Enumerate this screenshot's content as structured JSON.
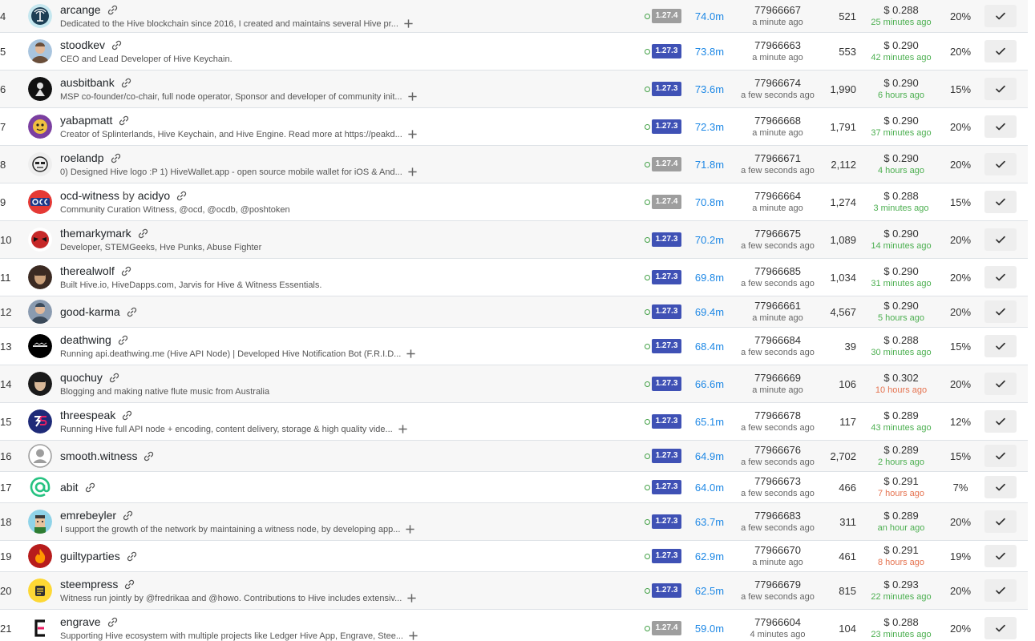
{
  "colors": {
    "version_current": "#3f51b5",
    "version_other": "#9e9e9e",
    "votes": "#1e88e5",
    "ago_recent": "#4caf50",
    "ago_stale": "#e57350",
    "status_online": "#43a047"
  },
  "witnesses": [
    {
      "rank": "4",
      "name": "arcange",
      "by": "",
      "proxy": "",
      "description": "Dedicated to the Hive blockchain since 2016, I created and maintains several Hive pr...",
      "expandable": true,
      "version": "1.27.4",
      "votes": "74.0m",
      "block": "77966667",
      "block_time": "a minute ago",
      "missed": "521",
      "price": "$ 0.288",
      "price_time": "25 minutes ago",
      "price_stale": false,
      "apr": "20%",
      "avatar_icon": "radio-tower-icon",
      "avatar_colors": [
        "#c5e7ef",
        "#1d3f55"
      ]
    },
    {
      "rank": "5",
      "name": "stoodkev",
      "by": "",
      "proxy": "",
      "description": "CEO and Lead Developer of Hive Keychain.",
      "expandable": false,
      "version": "1.27.3",
      "votes": "73.8m",
      "block": "77966663",
      "block_time": "a minute ago",
      "missed": "553",
      "price": "$ 0.290",
      "price_time": "42 minutes ago",
      "price_stale": false,
      "apr": "20%",
      "avatar_icon": "person-photo-icon",
      "avatar_colors": [
        "#a8c4de",
        "#6a4e3a"
      ]
    },
    {
      "rank": "6",
      "name": "ausbitbank",
      "by": "",
      "proxy": "",
      "description": "MSP co-founder/co-chair, full node operator, Sponsor and developer of community init...",
      "expandable": true,
      "version": "1.27.3",
      "votes": "73.6m",
      "block": "77966674",
      "block_time": "a few seconds ago",
      "missed": "1,990",
      "price": "$ 0.290",
      "price_time": "6 hours ago",
      "price_stale": false,
      "apr": "15%",
      "avatar_icon": "dark-figure-icon",
      "avatar_colors": [
        "#111111",
        "#e0e0e0"
      ]
    },
    {
      "rank": "7",
      "name": "yabapmatt",
      "by": "",
      "proxy": "",
      "description": "Creator of Splinterlands, Hive Keychain, and Hive Engine. Read more at https://peakd...",
      "expandable": true,
      "version": "1.27.3",
      "votes": "72.3m",
      "block": "77966668",
      "block_time": "a minute ago",
      "missed": "1,791",
      "price": "$ 0.290",
      "price_time": "37 minutes ago",
      "price_stale": false,
      "apr": "20%",
      "avatar_icon": "cartoon-face-icon",
      "avatar_colors": [
        "#7b3fa0",
        "#f0c040"
      ]
    },
    {
      "rank": "8",
      "name": "roelandp",
      "by": "",
      "proxy": "",
      "description": "0) Designed Hive logo :P 1) HiveWallet.app - open source mobile wallet for iOS & And...",
      "expandable": true,
      "version": "1.27.4",
      "votes": "71.8m",
      "block": "77966671",
      "block_time": "a few seconds ago",
      "missed": "2,112",
      "price": "$ 0.290",
      "price_time": "4 hours ago",
      "price_stale": false,
      "apr": "20%",
      "avatar_icon": "sketch-face-icon",
      "avatar_colors": [
        "#eeeeee",
        "#222222"
      ]
    },
    {
      "rank": "9",
      "name": "ocd-witness",
      "by": "by",
      "proxy": "acidyo",
      "description": "Community Curation Witness, @ocd, @ocdb, @poshtoken",
      "expandable": false,
      "version": "1.27.4",
      "votes": "70.8m",
      "block": "77966664",
      "block_time": "a minute ago",
      "missed": "1,274",
      "price": "$ 0.288",
      "price_time": "3 minutes ago",
      "price_stale": false,
      "apr": "15%",
      "avatar_icon": "ocd-logo-icon",
      "avatar_colors": [
        "#e53935",
        "#1e3a8a"
      ]
    },
    {
      "rank": "10",
      "name": "themarkymark",
      "by": "",
      "proxy": "",
      "description": "Developer, STEMGeeks, Hve Punks, Abuse Fighter",
      "expandable": false,
      "version": "1.27.3",
      "votes": "70.2m",
      "block": "77966675",
      "block_time": "a few seconds ago",
      "missed": "1,089",
      "price": "$ 0.290",
      "price_time": "14 minutes ago",
      "price_stale": false,
      "apr": "20%",
      "avatar_icon": "deadpool-icon",
      "avatar_colors": [
        "#c62828",
        "#111111"
      ]
    },
    {
      "rank": "11",
      "name": "therealwolf",
      "by": "",
      "proxy": "",
      "description": "Built Hive.io, HiveDapps.com, Jarvis for Hive & Witness Essentials.",
      "expandable": false,
      "version": "1.27.3",
      "votes": "69.8m",
      "block": "77966685",
      "block_time": "a few seconds ago",
      "missed": "1,034",
      "price": "$ 0.290",
      "price_time": "31 minutes ago",
      "price_stale": false,
      "apr": "20%",
      "avatar_icon": "portrait-icon",
      "avatar_colors": [
        "#3b2a22",
        "#caa07a"
      ]
    },
    {
      "rank": "12",
      "name": "good-karma",
      "by": "",
      "proxy": "",
      "description": "",
      "expandable": false,
      "version": "1.27.3",
      "votes": "69.4m",
      "block": "77966661",
      "block_time": "a minute ago",
      "missed": "4,567",
      "price": "$ 0.290",
      "price_time": "5 hours ago",
      "price_stale": false,
      "apr": "20%",
      "avatar_icon": "person-photo-icon",
      "avatar_colors": [
        "#8a9bb0",
        "#3b4a5a"
      ]
    },
    {
      "rank": "13",
      "name": "deathwing",
      "by": "",
      "proxy": "",
      "description": "Running api.deathwing.me (Hive API Node) | Developed Hive Notification Bot (F.R.I.D...",
      "expandable": true,
      "version": "1.27.3",
      "votes": "68.4m",
      "block": "77966684",
      "block_time": "a few seconds ago",
      "missed": "39",
      "price": "$ 0.288",
      "price_time": "30 minutes ago",
      "price_stale": false,
      "apr": "15%",
      "avatar_icon": "deathwing-logo-icon",
      "avatar_colors": [
        "#000000",
        "#dddddd"
      ]
    },
    {
      "rank": "14",
      "name": "quochuy",
      "by": "",
      "proxy": "",
      "description": "Blogging and making native flute music from Australia",
      "expandable": false,
      "version": "1.27.3",
      "votes": "66.6m",
      "block": "77966669",
      "block_time": "a minute ago",
      "missed": "106",
      "price": "$ 0.302",
      "price_time": "10 hours ago",
      "price_stale": true,
      "apr": "20%",
      "avatar_icon": "portrait-icon",
      "avatar_colors": [
        "#1a1a1a",
        "#d8b898"
      ]
    },
    {
      "rank": "15",
      "name": "threespeak",
      "by": "",
      "proxy": "",
      "description": "Running Hive full API node + encoding, content delivery, storage & high quality vide...",
      "expandable": true,
      "version": "1.27.3",
      "votes": "65.1m",
      "block": "77966678",
      "block_time": "a few seconds ago",
      "missed": "117",
      "price": "$ 0.289",
      "price_time": "43 minutes ago",
      "price_stale": false,
      "apr": "12%",
      "avatar_icon": "threespeak-logo-icon",
      "avatar_colors": [
        "#1e2a78",
        "#e91e63"
      ]
    },
    {
      "rank": "16",
      "name": "smooth.witness",
      "by": "",
      "proxy": "",
      "description": "",
      "expandable": false,
      "version": "1.27.3",
      "votes": "64.9m",
      "block": "77966676",
      "block_time": "a few seconds ago",
      "missed": "2,702",
      "price": "$ 0.289",
      "price_time": "2 hours ago",
      "price_stale": false,
      "apr": "15%",
      "avatar_icon": "default-user-icon",
      "avatar_colors": [
        "#ffffff",
        "#9e9e9e"
      ]
    },
    {
      "rank": "17",
      "name": "abit",
      "by": "",
      "proxy": "",
      "description": "",
      "expandable": false,
      "version": "1.27.3",
      "votes": "64.0m",
      "block": "77966673",
      "block_time": "a few seconds ago",
      "missed": "466",
      "price": "$ 0.291",
      "price_time": "7 hours ago",
      "price_stale": true,
      "apr": "7%",
      "avatar_icon": "at-sign-icon",
      "avatar_colors": [
        "#ffffff",
        "#26c281"
      ]
    },
    {
      "rank": "18",
      "name": "emrebeyler",
      "by": "",
      "proxy": "",
      "description": "I support the growth of the network by maintaining a witness node, by developing app...",
      "expandable": true,
      "version": "1.27.3",
      "votes": "63.7m",
      "block": "77966683",
      "block_time": "a few seconds ago",
      "missed": "311",
      "price": "$ 0.289",
      "price_time": "an hour ago",
      "price_stale": false,
      "apr": "20%",
      "avatar_icon": "pixel-face-icon",
      "avatar_colors": [
        "#8fd3e8",
        "#3a3a3a"
      ]
    },
    {
      "rank": "19",
      "name": "guiltyparties",
      "by": "",
      "proxy": "",
      "description": "",
      "expandable": false,
      "version": "1.27.3",
      "votes": "62.9m",
      "block": "77966670",
      "block_time": "a minute ago",
      "missed": "461",
      "price": "$ 0.291",
      "price_time": "8 hours ago",
      "price_stale": true,
      "apr": "19%",
      "avatar_icon": "fire-icon",
      "avatar_colors": [
        "#b71c1c",
        "#ff9800"
      ]
    },
    {
      "rank": "20",
      "name": "steempress",
      "by": "",
      "proxy": "",
      "description": "Witness run jointly by @fredrikaa and @howo. Contributions to Hive includes extensiv...",
      "expandable": true,
      "version": "1.27.3",
      "votes": "62.5m",
      "block": "77966679",
      "block_time": "a few seconds ago",
      "missed": "815",
      "price": "$ 0.293",
      "price_time": "22 minutes ago",
      "price_stale": false,
      "apr": "20%",
      "avatar_icon": "document-icon",
      "avatar_colors": [
        "#fdd835",
        "#333333"
      ]
    },
    {
      "rank": "21",
      "name": "engrave",
      "by": "",
      "proxy": "",
      "description": "Supporting Hive ecosystem with multiple projects like Ledger Hive App, Engrave, Stee...",
      "expandable": true,
      "version": "1.27.4",
      "votes": "59.0m",
      "block": "77966604",
      "block_time": "4 minutes ago",
      "missed": "104",
      "price": "$ 0.288",
      "price_time": "23 minutes ago",
      "price_stale": false,
      "apr": "20%",
      "avatar_icon": "engrave-logo-icon",
      "avatar_colors": [
        "#ffffff",
        "#111111"
      ]
    }
  ]
}
